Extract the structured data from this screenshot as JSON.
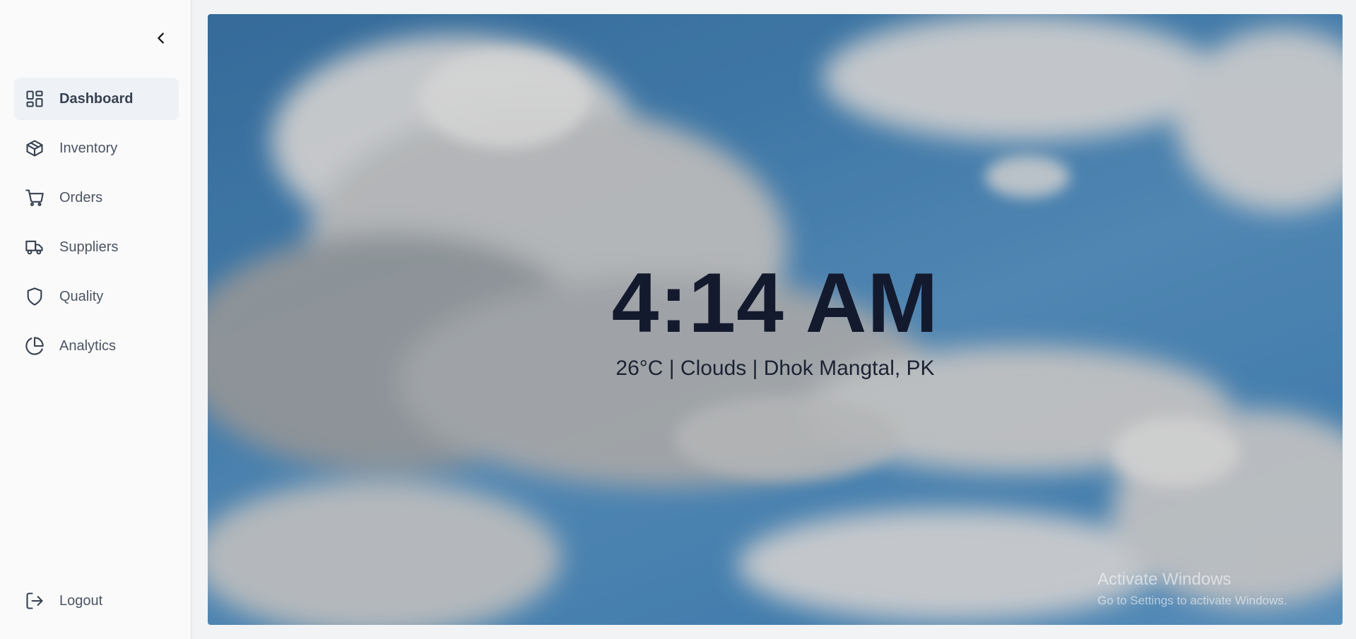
{
  "sidebar": {
    "collapse_icon": "chevron-left-icon",
    "items": [
      {
        "label": "Dashboard",
        "icon": "grid-icon",
        "active": true
      },
      {
        "label": "Inventory",
        "icon": "box-icon"
      },
      {
        "label": "Orders",
        "icon": "cart-icon"
      },
      {
        "label": "Suppliers",
        "icon": "truck-icon"
      },
      {
        "label": "Quality",
        "icon": "shield-icon"
      },
      {
        "label": "Analytics",
        "icon": "pie-chart-icon"
      }
    ],
    "logout": {
      "label": "Logout",
      "icon": "logout-icon"
    }
  },
  "hero": {
    "time": "4:14 AM",
    "weather": "26°C | Clouds | Dhok Mangtal, PK"
  },
  "watermark": {
    "title": "Activate Windows",
    "subtitle": "Go to Settings to activate Windows."
  },
  "colors": {
    "sidebar_bg": "#fafafa",
    "active_item_bg": "#eef2f7",
    "clock_text": "#141a2e",
    "sky": "#3a7fb8"
  }
}
